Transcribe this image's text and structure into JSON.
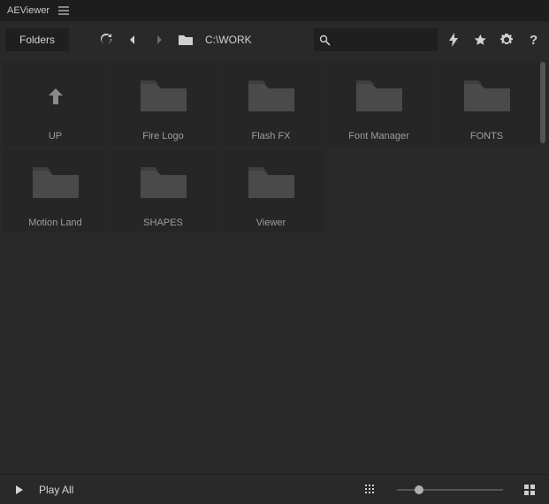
{
  "titlebar": {
    "title": "AEViewer"
  },
  "toolbar": {
    "folders_label": "Folders",
    "path": "C:\\WORK",
    "search_placeholder": ""
  },
  "grid": {
    "items": [
      {
        "label": "UP",
        "type": "up"
      },
      {
        "label": "Fire Logo",
        "type": "folder"
      },
      {
        "label": "Flash FX",
        "type": "folder"
      },
      {
        "label": "Font Manager",
        "type": "folder"
      },
      {
        "label": "FONTS",
        "type": "folder"
      },
      {
        "label": "Motion Land",
        "type": "folder"
      },
      {
        "label": "SHAPES",
        "type": "folder"
      },
      {
        "label": "Viewer",
        "type": "folder"
      }
    ]
  },
  "footer": {
    "play_label": "Play All"
  }
}
